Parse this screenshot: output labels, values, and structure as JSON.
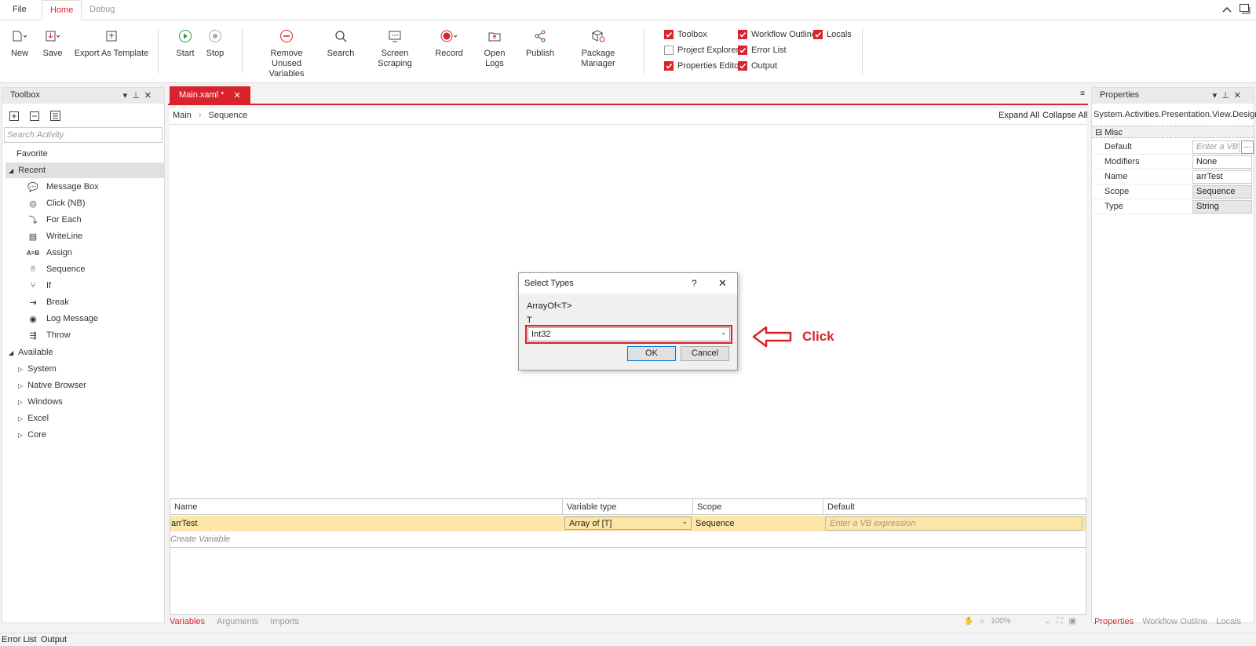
{
  "menubar": {
    "file": "File",
    "home": "Home",
    "debug": "Debug"
  },
  "ribbon": {
    "new": "New",
    "save": "Save",
    "export_template": "Export As Template",
    "start": "Start",
    "stop": "Stop",
    "remove_unused_1": "Remove Unused",
    "remove_unused_2": "Variables",
    "search": "Search",
    "screen_scraping": "Screen Scraping",
    "record": "Record",
    "open_logs": "Open Logs",
    "publish": "Publish",
    "package_manager": "Package Manager",
    "checks": {
      "toolbox": "Toolbox",
      "project_explorer": "Project Explorer",
      "properties_editor": "Properties Editor",
      "workflow_outline": "Workflow Outline",
      "error_list": "Error List",
      "output": "Output",
      "locals": "Locals"
    }
  },
  "toolbox": {
    "title": "Toolbox",
    "search_placeholder": "Search Activity",
    "favorite": "Favorite",
    "recent": "Recent",
    "recent_items": [
      "Message Box",
      "Click (NB)",
      "For Each",
      "WriteLine",
      "Assign",
      "Sequence",
      "If",
      "Break",
      "Log Message",
      "Throw"
    ],
    "available": "Available",
    "available_items": [
      "System",
      "Native Browser",
      "Windows",
      "Excel",
      "Core"
    ]
  },
  "document": {
    "tab": "Main.xaml *",
    "breadcrumb_main": "Main",
    "breadcrumb_sequence": "Sequence",
    "expand_all": "Expand All",
    "collapse_all": "Collapse All"
  },
  "dialog": {
    "title": "Select Types",
    "help": "?",
    "type_label": "ArrayOf<T>",
    "param_label": "T",
    "selected_type": "Int32",
    "ok": "OK",
    "cancel": "Cancel"
  },
  "annotation": {
    "text": "Click",
    "color": "#d9232d"
  },
  "variables": {
    "headers": [
      "Name",
      "Variable type",
      "Scope",
      "Default"
    ],
    "row": {
      "name": "arrTest",
      "type": "Array of [T]",
      "scope": "Sequence",
      "default_placeholder": "Enter a VB expression"
    },
    "create": "Create Variable",
    "tabs": [
      "Variables",
      "Arguments",
      "Imports"
    ],
    "zoom": "100%"
  },
  "properties": {
    "title": "Properties",
    "subtitle": "System.Activities.Presentation.View.Design...",
    "category": "Misc",
    "rows": [
      {
        "label": "Default",
        "value": "Enter a VB e"
      },
      {
        "label": "Modifiers",
        "value": "None"
      },
      {
        "label": "Name",
        "value": "arrTest"
      },
      {
        "label": "Scope",
        "value": "Sequence"
      },
      {
        "label": "Type",
        "value": "String"
      }
    ],
    "tabs": [
      "Properties",
      "Workflow Outline",
      "Locals"
    ]
  },
  "bottom": {
    "error_list": "Error List",
    "output": "Output"
  },
  "colors": {
    "accent": "#d9232d",
    "highlight": "#fce7a8"
  }
}
